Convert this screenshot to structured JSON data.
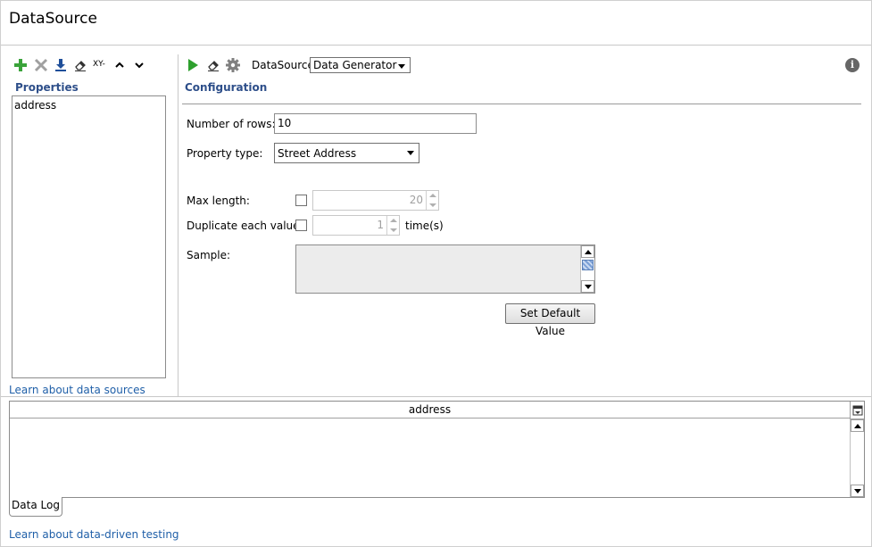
{
  "window": {
    "title": "DataSource"
  },
  "left_toolbar": {
    "icons": [
      "add-icon",
      "delete-icon",
      "download-icon",
      "eraser-icon",
      "xy-icon",
      "move-up-icon",
      "move-down-icon"
    ],
    "xy_label": "XY-"
  },
  "properties": {
    "label": "Properties",
    "items": [
      "address"
    ],
    "link": "Learn about data sources"
  },
  "right_toolbar": {
    "icons": [
      "run-icon",
      "eraser-icon",
      "gear-icon"
    ],
    "datasource_label": "DataSource:",
    "datasource_value": "Data Generator",
    "info_icon": "info-icon",
    "info_glyph": "i"
  },
  "configuration": {
    "label": "Configuration",
    "rows_label": "Number of rows:",
    "rows_value": "10",
    "property_type_label": "Property type:",
    "property_type_value": "Street Address",
    "max_length_label": "Max length:",
    "max_length_value": "20",
    "duplicate_label": "Duplicate each value:",
    "duplicate_value": "1",
    "duplicate_unit": "time(s)",
    "sample_label": "Sample:",
    "set_default_button": "Set Default Value"
  },
  "data_grid": {
    "columns": [
      "address"
    ],
    "tab": "Data Log"
  },
  "footer": {
    "link": "Learn about data-driven testing"
  },
  "colors": {
    "accent_label": "#2e4f8a",
    "link": "#1f5fa8",
    "add_green": "#3aa33a",
    "run_green": "#2ea02e"
  }
}
